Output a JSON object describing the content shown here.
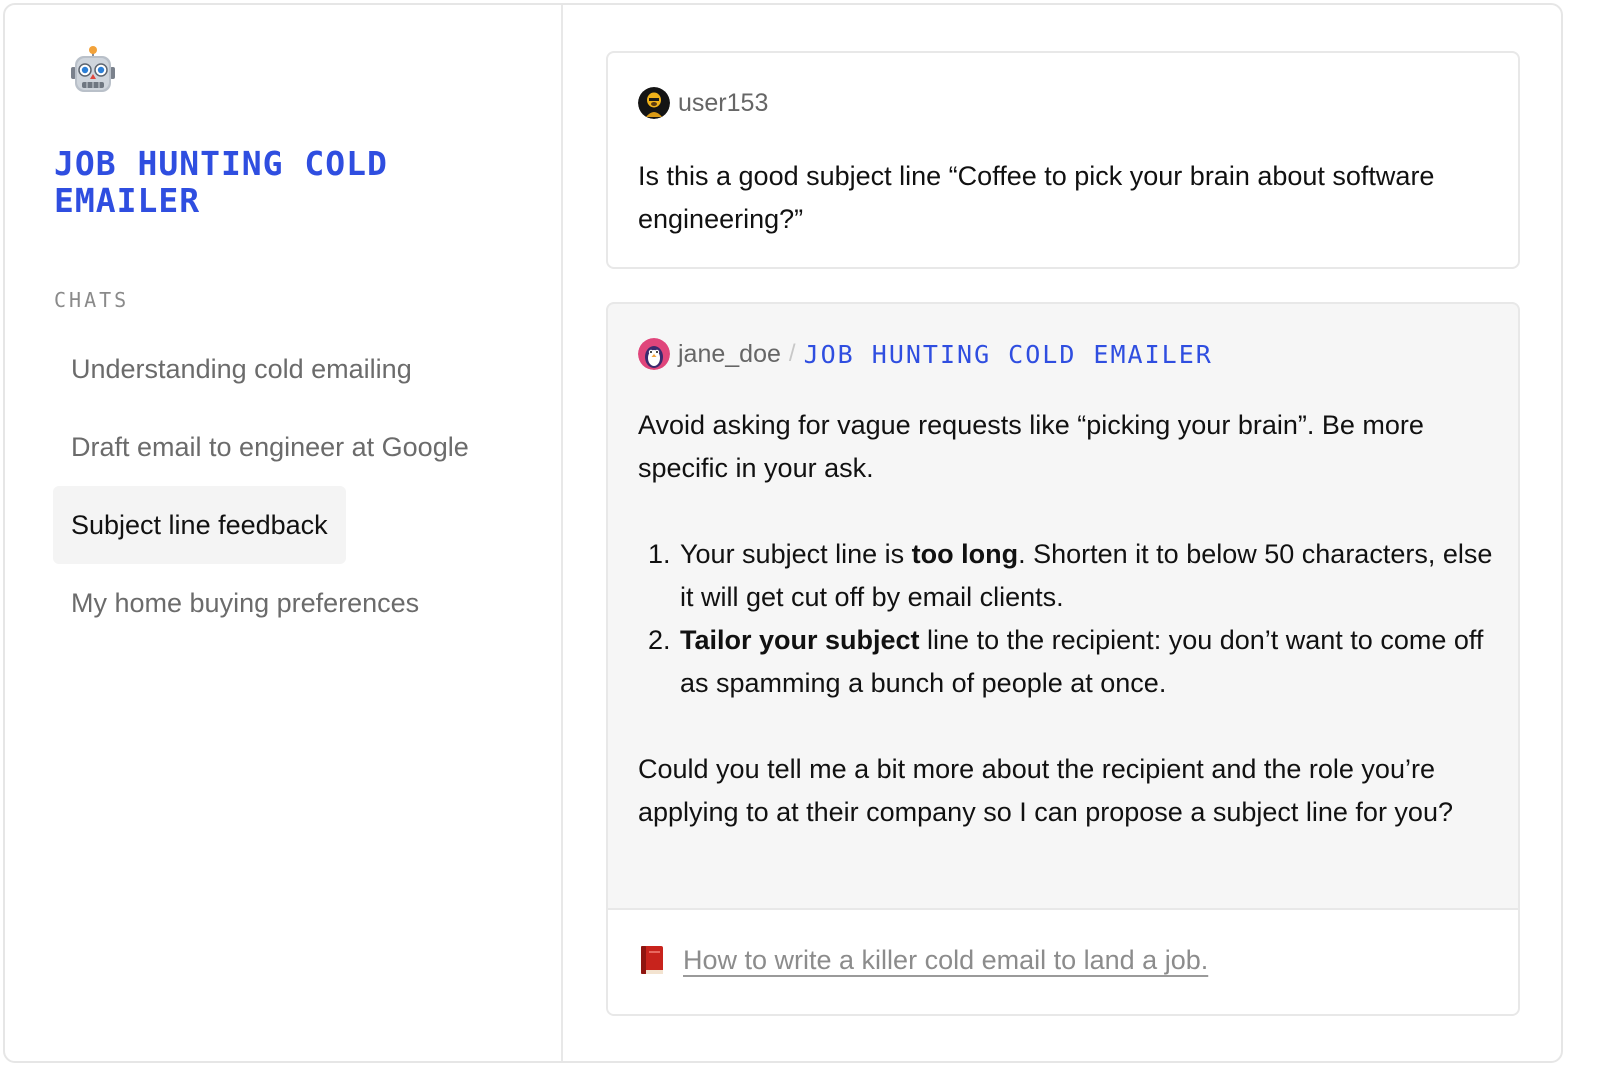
{
  "sidebar": {
    "app_icon": "robot-icon",
    "app_title": "JOB HUNTING COLD EMAILER",
    "section_label": "CHATS",
    "chats": [
      {
        "label": "Understanding cold emailing",
        "active": false
      },
      {
        "label": "Draft email to engineer at Google",
        "active": false
      },
      {
        "label": "Subject line feedback",
        "active": true
      },
      {
        "label": "My home buying preferences",
        "active": false
      }
    ]
  },
  "conversation": {
    "user_message": {
      "username": "user153",
      "avatar_icon": "user-avatar",
      "text": "Is this a good subject line “Coffee to pick your brain about software engineering?”"
    },
    "assistant_message": {
      "username": "jane_doe",
      "avatar_icon": "penguin-avatar",
      "separator": "/",
      "assistant_name": "JOB HUNTING COLD EMAILER",
      "intro": "Avoid asking for vague requests like “picking your brain”. Be more specific in your ask.",
      "points": [
        {
          "prefix": "Your subject line is ",
          "bold": "too long",
          "suffix": ". Shorten it to below 50 characters, else it will get cut off by email clients."
        },
        {
          "prefix": "",
          "bold": "Tailor your subject",
          "suffix": " line to the recipient: you don’t want to come off as spamming a bunch of people at once."
        }
      ],
      "closing": "Could you tell me a bit more about the recipient and the role you’re applying to at their company so I can propose a subject line for you?",
      "reference": {
        "icon": "book-icon",
        "link_text": "How to write a killer cold email to land a job."
      }
    }
  },
  "colors": {
    "accent": "#2f4ee0",
    "muted_text": "#6b6b6b",
    "active_bg": "#f4f4f4",
    "assistant_card_bg": "#f6f6f6",
    "border": "#e8e8e8"
  }
}
